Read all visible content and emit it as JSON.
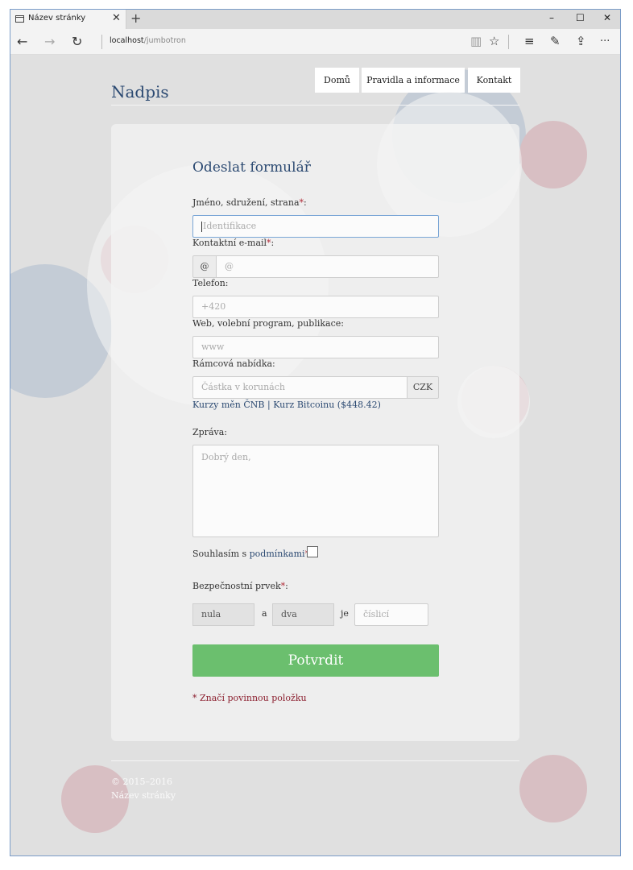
{
  "browser": {
    "tab_title": "Název stránky",
    "tab_close": "✕",
    "new_tab": "+",
    "url_host": "localhost",
    "url_path": "/jumbotron",
    "nav_back": "←",
    "nav_forward": "→",
    "nav_refresh": "↻",
    "win_minimize": "–",
    "win_maximize": "☐",
    "win_close": "✕",
    "toolbar_icons": [
      "reading-view-icon",
      "favorite-star-icon",
      "hub-icon",
      "web-note-icon",
      "share-icon",
      "more-icon"
    ],
    "reading_view": "▥",
    "favorite": "☆",
    "hub": "≡",
    "web_note": "✎",
    "share": "⇪",
    "more": "···"
  },
  "header": {
    "brand": "Nadpis",
    "nav": [
      "Domů",
      "Pravidla a informace",
      "Kontakt"
    ]
  },
  "form": {
    "title": "Odeslat formulář",
    "required_mark": "*",
    "name_label": "Jméno, sdružení, strana",
    "name_placeholder": "Identifikace",
    "email_label": "Kontaktní e-mail",
    "email_addon": "@",
    "email_placeholder": "@",
    "phone_label": "Telefon:",
    "phone_placeholder": "+420",
    "web_label": "Web, volební program, publikace:",
    "web_placeholder": "www",
    "offer_label": "Rámcová nabídka:",
    "offer_placeholder": "Částka v korunách",
    "offer_addon": "CZK",
    "rate_link_cnb": "Kurzy měn ČNB",
    "rate_separator": "|",
    "rate_link_btc": "Kurz Bitcoinu ($448.42)",
    "message_label": "Zpráva:",
    "message_placeholder": "Dobrý den,",
    "consent_prefix": "Souhlasím s",
    "consent_link": "podmínkami",
    "captcha_label": "Bezpečnostní prvek",
    "captcha_a": "nula",
    "captcha_and": "a",
    "captcha_b": "dva",
    "captcha_is": "je",
    "captcha_placeholder": "číslicí",
    "submit": "Potvrdit",
    "required_note": "* Značí povinnou položku"
  },
  "footer": {
    "copyright": "© 2015–2016",
    "site_name": "Název stránky"
  },
  "colors": {
    "brand": "#2c4a72",
    "submit": "#6bbf6e",
    "required": "#b02a37"
  }
}
